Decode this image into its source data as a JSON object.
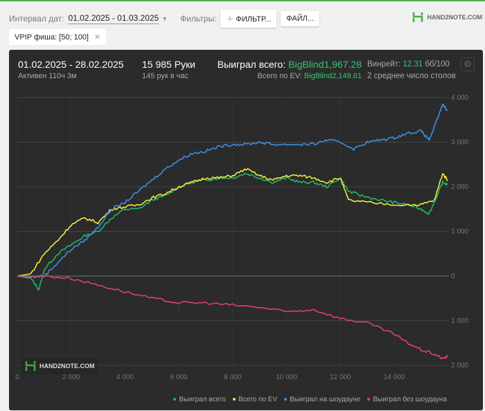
{
  "toolbar": {
    "date_label": "Интервал дат:",
    "date_range": "01.02.2025 - 01.03.2025",
    "filters_label": "Фильтры:",
    "filter_button": "ФИЛЬТР...",
    "file_button": "ФАЙЛ...",
    "logo": "HAND2NOTE.COM"
  },
  "chip": {
    "label": "VPIP фиша: [50; 100]"
  },
  "summary": {
    "period": "01.02.2025 - 28.02.2025",
    "active": "Активен 110ч 3м",
    "hands": "15 985 Руки",
    "hands_per_hour": "145 рук в час",
    "won_label": "Выиграл всего:",
    "won_value": "BigBlind1,967.28",
    "ev_label": "Всего по EV:",
    "ev_value": "BigBlind2,149.61",
    "winrate_label": "Винрейт:",
    "winrate_value": "12.31",
    "winrate_unit": "бб/100",
    "tables": "2 среднее число столов"
  },
  "watermark": "HAND2NOTE.COM",
  "colors": {
    "green": "#1fb86a",
    "yellow": "#f0ea3a",
    "blue": "#3d8fe0",
    "red": "#e0406e"
  },
  "chart_data": {
    "type": "line",
    "xlim": [
      0,
      15985
    ],
    "ylim": [
      -2000,
      4000
    ],
    "x_ticks": [
      "0",
      "2 000",
      "4 000",
      "6 000",
      "8 000",
      "10 000",
      "12 000",
      "14 000"
    ],
    "x_tick_values": [
      0,
      2000,
      4000,
      6000,
      8000,
      10000,
      12000,
      14000
    ],
    "y_ticks": [
      "4 000",
      "3 000",
      "2 000",
      "1 000",
      "0",
      "1 000",
      "2 000"
    ],
    "y_tick_values": [
      4000,
      3000,
      2000,
      1000,
      0,
      -1000,
      -2000
    ],
    "series": [
      {
        "name": "Выиграл всего",
        "color": "#1fb86a",
        "x": [
          0,
          500,
          800,
          1000,
          1500,
          2000,
          2500,
          3000,
          3500,
          4000,
          4500,
          5000,
          5500,
          6000,
          6500,
          7000,
          7500,
          8000,
          8500,
          9000,
          9500,
          10000,
          10500,
          11000,
          11500,
          12000,
          12300,
          12800,
          13500,
          14000,
          14500,
          15000,
          15300,
          15600,
          15800,
          15985
        ],
        "y": [
          0,
          -50,
          -300,
          150,
          500,
          700,
          900,
          1000,
          1300,
          1500,
          1500,
          1700,
          1800,
          2000,
          2100,
          2150,
          2200,
          2200,
          2300,
          2200,
          2100,
          2200,
          2100,
          2100,
          2000,
          2200,
          1900,
          1800,
          1700,
          1650,
          1600,
          1500,
          1400,
          1800,
          2100,
          2050
        ]
      },
      {
        "name": "Всего по EV",
        "color": "#f0ea3a",
        "x": [
          0,
          500,
          1000,
          1500,
          2000,
          2500,
          3000,
          3500,
          4000,
          4500,
          5000,
          5500,
          6000,
          6500,
          7000,
          7500,
          8000,
          8500,
          9000,
          9500,
          10000,
          10500,
          11000,
          11500,
          12000,
          12300,
          13000,
          14000,
          15000,
          15500,
          15800,
          15985
        ],
        "y": [
          0,
          50,
          500,
          800,
          1150,
          1300,
          1200,
          1500,
          1550,
          1600,
          1750,
          1850,
          2000,
          2100,
          2200,
          2200,
          2250,
          2400,
          2250,
          2150,
          2250,
          2250,
          2200,
          2100,
          2200,
          1700,
          1650,
          1600,
          1600,
          1700,
          2300,
          2150
        ]
      },
      {
        "name": "Выиграл на шоудауне",
        "color": "#3d8fe0",
        "x": [
          0,
          500,
          1000,
          1500,
          2000,
          2500,
          3000,
          3500,
          4000,
          4500,
          5000,
          5500,
          6000,
          6500,
          7000,
          7500,
          8000,
          8500,
          9000,
          9500,
          10000,
          10500,
          11000,
          11500,
          12000,
          12500,
          13000,
          13500,
          14000,
          14500,
          15000,
          15300,
          15600,
          15800,
          15985
        ],
        "y": [
          0,
          -20,
          0,
          300,
          600,
          800,
          1100,
          1500,
          1650,
          1900,
          2150,
          2400,
          2600,
          2750,
          2800,
          2900,
          2950,
          2950,
          3000,
          2950,
          2950,
          2950,
          2950,
          3050,
          3000,
          2850,
          3000,
          3050,
          3100,
          3200,
          3250,
          3050,
          3500,
          3850,
          3700
        ]
      },
      {
        "name": "Выиграл без шоудауна",
        "color": "#e0406e",
        "x": [
          0,
          1000,
          2000,
          3000,
          4000,
          5000,
          6000,
          7000,
          8000,
          9000,
          10000,
          11000,
          12000,
          13000,
          14000,
          14500,
          15000,
          15500,
          15800,
          15985
        ],
        "y": [
          0,
          0,
          -50,
          -200,
          -350,
          -500,
          -600,
          -600,
          -650,
          -700,
          -800,
          -750,
          -950,
          -1050,
          -1300,
          -1500,
          -1650,
          -1750,
          -1850,
          -1800
        ]
      }
    ]
  }
}
